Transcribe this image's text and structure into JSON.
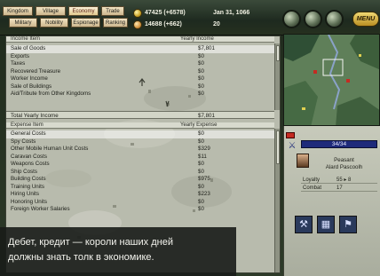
{
  "top_bar": {
    "nav_row1": [
      "Kingdom",
      "Village",
      "Economy",
      "Trade"
    ],
    "nav_row2": [
      "Military",
      "Nobility",
      "Espionage",
      "Ranking"
    ],
    "gold": "47425 (+6578)",
    "date": "Jan 31, 1066",
    "food": "14688 (+662)",
    "turn": "20",
    "menu_label": "MENU"
  },
  "income": {
    "header_item": "Income Item",
    "header_value": "Yearly Income",
    "rows": [
      {
        "label": "Sale of Goods",
        "value": "$7,801"
      },
      {
        "label": "Exports",
        "value": "$0"
      },
      {
        "label": "Taxes",
        "value": "$0"
      },
      {
        "label": "Recovered Treasure",
        "value": "$0"
      },
      {
        "label": "Worker Income",
        "value": "$0"
      },
      {
        "label": "Sale of Buildings",
        "value": "$0"
      },
      {
        "label": "Aid/Tribute from Other Kingdoms",
        "value": "$0"
      }
    ],
    "total_label": "Total Yearly Income",
    "total_value": "$7,801"
  },
  "expense": {
    "header_item": "Expense Item",
    "header_value": "Yearly Expense",
    "rows": [
      {
        "label": "General Costs",
        "value": "$0"
      },
      {
        "label": "Spy Costs",
        "value": "$0"
      },
      {
        "label": "Other Mobile Human Unit Costs",
        "value": "$329"
      },
      {
        "label": "Caravan Costs",
        "value": "$11"
      },
      {
        "label": "Weapons Costs",
        "value": "$0"
      },
      {
        "label": "Ship Costs",
        "value": "$0"
      },
      {
        "label": "Building Costs",
        "value": "$975"
      },
      {
        "label": "Training Units",
        "value": "$0"
      },
      {
        "label": "Hiring Units",
        "value": "$223"
      },
      {
        "label": "Honoring Units",
        "value": "$0"
      },
      {
        "label": "Foreign Worker Salaries",
        "value": "$0"
      }
    ]
  },
  "caption": {
    "line1": "Дебет, кредит — короли наших дней",
    "line2": "должны знать толк в экономике."
  },
  "unit_panel": {
    "hit_points": "34/34",
    "unit_type": "Peasant",
    "unit_name": "Alard Pascoolh",
    "stats": [
      {
        "key": "Loyalty",
        "value": "55 ▸ 8"
      },
      {
        "key": "Combat",
        "value": "17"
      }
    ],
    "action_icons": [
      "settle-icon",
      "build-icon",
      "nation-icon"
    ]
  },
  "colors": {
    "panel_bg": "#b9bcae",
    "header_bg": "#d8dace",
    "menu_gold": "#d9b44a",
    "hp_bar": "#1e2a7a",
    "caption_bg": "#181c18"
  }
}
